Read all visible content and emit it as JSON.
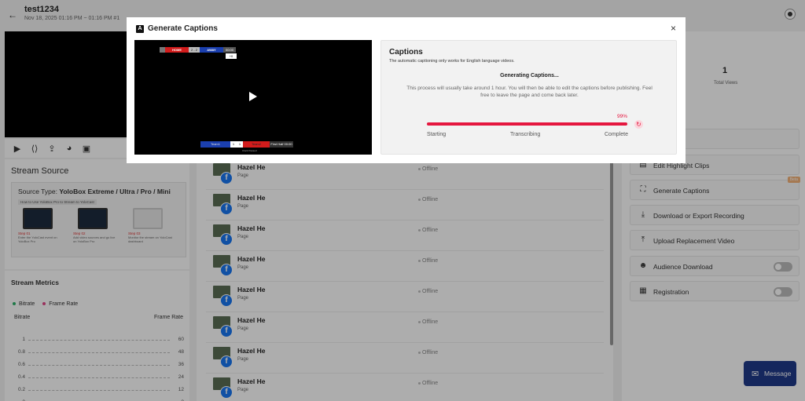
{
  "page": {
    "title": "test1234",
    "date_range": "Nov 18, 2025 01:16 PM ~ 01:16 PM #1",
    "back_icon": "arrow-left-icon",
    "top_right_icon": "compass-icon"
  },
  "left": {
    "tool_icons": [
      "play-icon",
      "embed-icon",
      "share-icon",
      "palette-icon",
      "camera-switch-icon"
    ],
    "stream_source": {
      "title": "Stream Source",
      "source_type_label": "Source Type:",
      "source_type_value": "YoloBox Extreme / Ultra / Pro / Mini",
      "howto": "How to Use YoloBox Pro to Stream to YoloCast",
      "steps": [
        {
          "label": "Step 01",
          "desc": "Enter the YoloCast event on YoloBox Pro"
        },
        {
          "label": "Step 02",
          "desc": "Add video sources and go live on YoloBox Pro"
        },
        {
          "label": "Step 03",
          "desc": "Monitor the stream on YoloCast dashboard"
        }
      ]
    },
    "metrics": {
      "title": "Stream Metrics",
      "legend": [
        {
          "name": "Bitrate",
          "color": "#2fb36a"
        },
        {
          "name": "Frame Rate",
          "color": "#e24a8a"
        }
      ],
      "left_axis_label": "Bitrate",
      "right_axis_label": "Frame Rate",
      "left_ticks": [
        "1",
        "0.8",
        "0.6",
        "0.4",
        "0.2",
        "0"
      ],
      "right_ticks": [
        "60",
        "48",
        "36",
        "24",
        "12",
        "0"
      ]
    }
  },
  "destinations": [
    {
      "name": "Hazel He",
      "type": "Page",
      "status": "Offline"
    },
    {
      "name": "Hazel He",
      "type": "Page",
      "status": "Offline"
    },
    {
      "name": "Hazel He",
      "type": "Page",
      "status": "Offline"
    },
    {
      "name": "Hazel He",
      "type": "Page",
      "status": "Offline"
    },
    {
      "name": "Hazel He",
      "type": "Page",
      "status": "Offline"
    },
    {
      "name": "Hazel He",
      "type": "Page",
      "status": "Offline"
    },
    {
      "name": "Hazel He",
      "type": "Page",
      "status": "Offline"
    },
    {
      "name": "Hazel He",
      "type": "Page",
      "status": "Offline"
    }
  ],
  "right": {
    "views_count": "1",
    "views_label": "Total Views",
    "actions": [
      {
        "label": "ding",
        "icon": "recording-icon"
      },
      {
        "label": "Edit Highlight Clips",
        "icon": "clips-icon"
      },
      {
        "label": "Generate Captions",
        "icon": "captions-icon",
        "badge": "Beta"
      },
      {
        "label": "Download or Export Recording",
        "icon": "download-icon"
      },
      {
        "label": "Upload Replacement Video",
        "icon": "upload-icon"
      },
      {
        "label": "Audience Download",
        "icon": "user-download-icon",
        "toggle": false
      },
      {
        "label": "Registration",
        "icon": "registration-icon",
        "toggle": false
      }
    ]
  },
  "message_button": {
    "label": "Message",
    "icon": "message-icon"
  },
  "modal": {
    "title": "Generate Captions",
    "logo_letter": "A",
    "close_label": "×",
    "scoreboard": {
      "home": "HOME",
      "score": "2 - 2",
      "away": "AWAY",
      "time": "00:00",
      "extra": "+0",
      "team_a": "Team1",
      "team_a_score": "1",
      "team_b_score": "1",
      "team_b": "Team2",
      "period": "First Half",
      "period_time": "00:00",
      "clock": "Clock Paused"
    },
    "captions": {
      "title": "Captions",
      "subtitle": "The automatic captioning only works for English language videos.",
      "status": "Generating Captions...",
      "description": "This process will usually take around 1 hour. You will then be able to edit the captions before publishing. Feel free to leave the page and come back later.",
      "progress_percent": 99,
      "progress_label": "99%",
      "stages": [
        "Starting",
        "Transcribing",
        "Complete"
      ],
      "accent_color": "#e5173f"
    }
  }
}
